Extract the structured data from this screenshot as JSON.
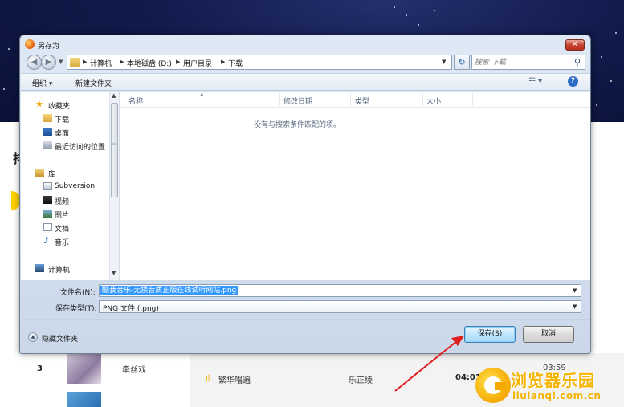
{
  "dialog": {
    "title": "另存为",
    "close_glyph": "✕",
    "nav": {
      "back_glyph": "◀",
      "forward_glyph": "▶",
      "breadcrumbs": [
        "计算机",
        "本地磁盘 (D:)",
        "用户目录",
        "下载"
      ],
      "refresh_glyph": "↻",
      "search_placeholder": "搜索 下载"
    },
    "toolbar": {
      "organize_label": "组织 ▾",
      "new_folder_label": "新建文件夹",
      "view_glyph": "☷ ▾",
      "help_glyph": "?"
    },
    "nav_pane": {
      "items": [
        {
          "label": "收藏夹",
          "icon": "star-icon"
        },
        {
          "label": "下载",
          "icon": "download-folder-icon"
        },
        {
          "label": "桌面",
          "icon": "desktop-icon"
        },
        {
          "label": "最近访问的位置",
          "icon": "recent-places-icon"
        },
        {
          "label": "库",
          "icon": "library-icon"
        },
        {
          "label": "Subversion",
          "icon": "subversion-icon"
        },
        {
          "label": "视频",
          "icon": "video-icon"
        },
        {
          "label": "图片",
          "icon": "picture-icon"
        },
        {
          "label": "文档",
          "icon": "document-icon"
        },
        {
          "label": "音乐",
          "icon": "music-icon"
        },
        {
          "label": "计算机",
          "icon": "computer-icon"
        }
      ]
    },
    "file_list": {
      "columns": [
        "名称",
        "修改日期",
        "类型",
        "大小"
      ],
      "empty_message": "没有与搜索条件匹配的项。"
    },
    "filename_label": "文件名(N):",
    "filename_value": "酷我音乐-无损音质正版在线试听网站.png",
    "filetype_label": "保存类型(T):",
    "filetype_value": "PNG 文件 (.png)",
    "hide_folders_label": "隐藏文件夹",
    "save_label": "保存(S)",
    "cancel_label": "取消"
  },
  "background_page": {
    "heading_char": "排",
    "row": {
      "rank": "3",
      "song_left": "牵丝戏",
      "duration_top": "03:59",
      "song_right": "繁华唱遍",
      "singer": "乐正绫",
      "duration": "04:01"
    }
  },
  "watermark": {
    "name_cn": "浏览器乐园",
    "domain": "liulanqi.com.cn"
  },
  "colors": {
    "banner": "#111a4a",
    "selection": "#3399ff",
    "arrow": "#e02020",
    "watermark": "#f5b400"
  }
}
